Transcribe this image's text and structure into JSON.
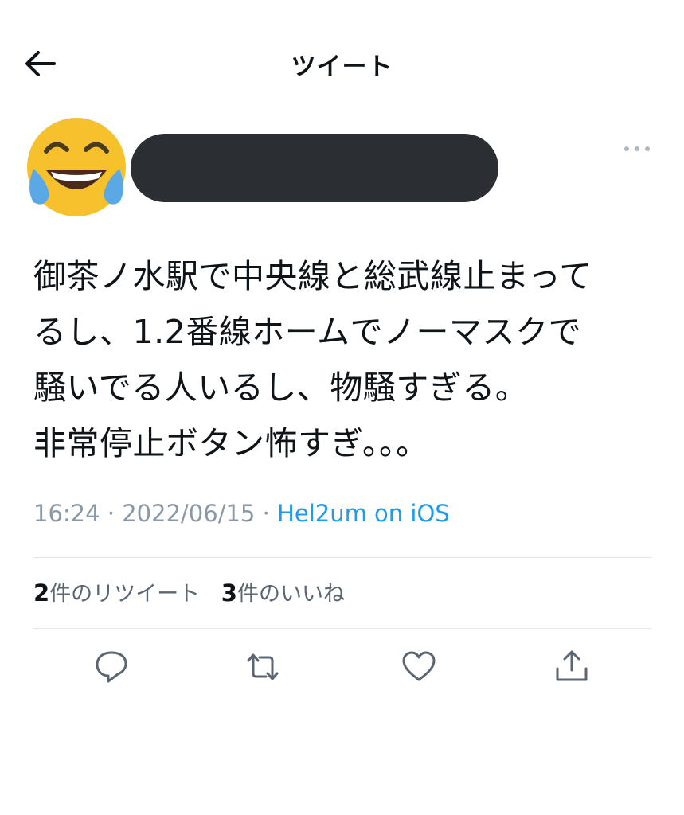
{
  "header": {
    "title": "ツイート",
    "back_icon": "arrow-left-icon"
  },
  "author": {
    "avatar_icon": "face-with-tears-of-joy-emoji",
    "more_icon": "more-horizontal-icon"
  },
  "tweet": {
    "text": "御茶ノ水駅で中央線と総武線止まって\nるし、1.2番線ホームでノーマスクで\n騒いでる人いるし、物騒すぎる。\n非常停止ボタン怖すぎ。。。",
    "time": "16:24",
    "separator": " · ",
    "date": "2022/06/15",
    "source": "Hel2um on iOS"
  },
  "stats": {
    "retweets_count": "2",
    "retweets_label": "件のリツイート",
    "likes_count": "3",
    "likes_label": "件のいいね"
  },
  "actions": {
    "reply_icon": "reply-icon",
    "retweet_icon": "retweet-icon",
    "like_icon": "heart-icon",
    "share_icon": "share-icon"
  },
  "colors": {
    "accent": "#1d9bf0",
    "muted": "#8b98a5",
    "redaction": "#2b2f33",
    "emoji_face": "#f7c12e"
  }
}
